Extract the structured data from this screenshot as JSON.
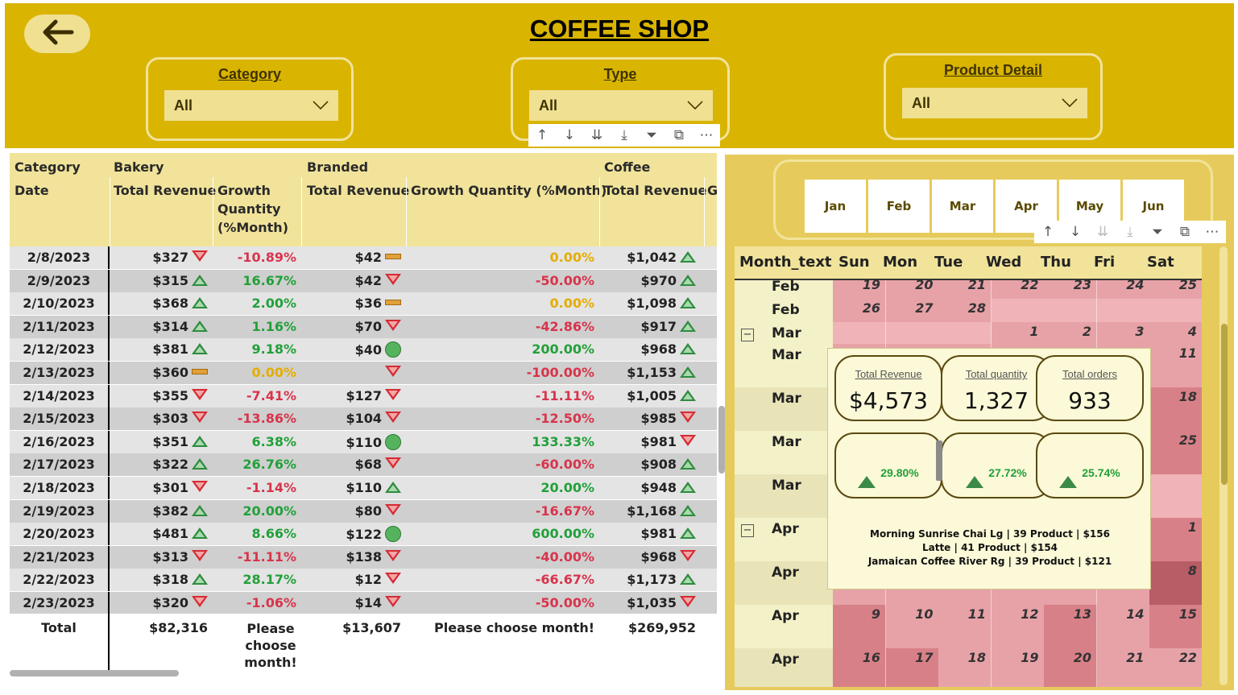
{
  "title": "COFFEE SHOP",
  "colors": {
    "header_bg": "#d9b400",
    "slicer_bg": "#efe092",
    "table_header_bg": "#f1e39a",
    "positive": "#22a03a",
    "negative": "#d8344b",
    "neutral": "#e5ad00"
  },
  "icons": {
    "back": "back-arrow-icon",
    "dropdown": "chevron-down-icon"
  },
  "filters": [
    {
      "title": "Category",
      "value": "All"
    },
    {
      "title": "Type",
      "value": "All"
    },
    {
      "title": "Product Detail",
      "value": "All"
    }
  ],
  "table_toolbar": [
    "sort-ascending-icon",
    "sort-descending-icon",
    "expand-all-icon",
    "drill-down-icon",
    "filter-icon",
    "focus-mode-icon",
    "more-options-icon"
  ],
  "table": {
    "row_header_title": "Category",
    "date_header": "Date",
    "groups": [
      {
        "name": "Bakery",
        "revenue_label": "Total Revenue",
        "growth_label": "Growth Quantity (%Month)"
      },
      {
        "name": "Branded",
        "revenue_label": "Total Revenue",
        "growth_label": "Growth Quantity (%Month)"
      },
      {
        "name": "Coffee",
        "revenue_label": "Total Revenue",
        "growth_label": "G"
      }
    ],
    "growth_wrapped": [
      "Growth",
      "Quantity",
      "(%Month)"
    ],
    "rows": [
      {
        "date": "2/8/2023",
        "bak_rev": "$327",
        "bak_icon": "down",
        "bak_gr": "-10.89%",
        "bak_cls": "neg",
        "brd_rev": "$42",
        "brd_icon": "flat",
        "brd_gr": "0.00%",
        "brd_cls": "zero",
        "cof_rev": "$1,042",
        "cof_icon": "up"
      },
      {
        "date": "2/9/2023",
        "bak_rev": "$315",
        "bak_icon": "up",
        "bak_gr": "16.67%",
        "bak_cls": "pos",
        "brd_rev": "$42",
        "brd_icon": "down",
        "brd_gr": "-50.00%",
        "brd_cls": "neg",
        "cof_rev": "$970",
        "cof_icon": "up"
      },
      {
        "date": "2/10/2023",
        "bak_rev": "$368",
        "bak_icon": "up",
        "bak_gr": "2.00%",
        "bak_cls": "pos",
        "brd_rev": "$36",
        "brd_icon": "flat",
        "brd_gr": "0.00%",
        "brd_cls": "zero",
        "cof_rev": "$1,098",
        "cof_icon": "up"
      },
      {
        "date": "2/11/2023",
        "bak_rev": "$314",
        "bak_icon": "up",
        "bak_gr": "1.16%",
        "bak_cls": "pos",
        "brd_rev": "$70",
        "brd_icon": "down",
        "brd_gr": "-42.86%",
        "brd_cls": "neg",
        "cof_rev": "$917",
        "cof_icon": "up"
      },
      {
        "date": "2/12/2023",
        "bak_rev": "$381",
        "bak_icon": "up",
        "bak_gr": "9.18%",
        "bak_cls": "pos",
        "brd_rev": "$40",
        "brd_icon": "circle",
        "brd_gr": "200.00%",
        "brd_cls": "pos",
        "cof_rev": "$968",
        "cof_icon": "up"
      },
      {
        "date": "2/13/2023",
        "bak_rev": "$360",
        "bak_icon": "flat",
        "bak_gr": "0.00%",
        "bak_cls": "zero",
        "brd_rev": "",
        "brd_icon": "down",
        "brd_gr": "-100.00%",
        "brd_cls": "neg",
        "cof_rev": "$1,153",
        "cof_icon": "up"
      },
      {
        "date": "2/14/2023",
        "bak_rev": "$355",
        "bak_icon": "down",
        "bak_gr": "-7.41%",
        "bak_cls": "neg",
        "brd_rev": "$127",
        "brd_icon": "down",
        "brd_gr": "-11.11%",
        "brd_cls": "neg",
        "cof_rev": "$1,005",
        "cof_icon": "up"
      },
      {
        "date": "2/15/2023",
        "bak_rev": "$303",
        "bak_icon": "down",
        "bak_gr": "-13.86%",
        "bak_cls": "neg",
        "brd_rev": "$104",
        "brd_icon": "down",
        "brd_gr": "-12.50%",
        "brd_cls": "neg",
        "cof_rev": "$985",
        "cof_icon": "down"
      },
      {
        "date": "2/16/2023",
        "bak_rev": "$351",
        "bak_icon": "up",
        "bak_gr": "6.38%",
        "bak_cls": "pos",
        "brd_rev": "$110",
        "brd_icon": "circle",
        "brd_gr": "133.33%",
        "brd_cls": "pos",
        "cof_rev": "$981",
        "cof_icon": "down"
      },
      {
        "date": "2/17/2023",
        "bak_rev": "$322",
        "bak_icon": "up",
        "bak_gr": "26.76%",
        "bak_cls": "pos",
        "brd_rev": "$68",
        "brd_icon": "down",
        "brd_gr": "-60.00%",
        "brd_cls": "neg",
        "cof_rev": "$908",
        "cof_icon": "up"
      },
      {
        "date": "2/18/2023",
        "bak_rev": "$301",
        "bak_icon": "down",
        "bak_gr": "-1.14%",
        "bak_cls": "neg",
        "brd_rev": "$110",
        "brd_icon": "up",
        "brd_gr": "20.00%",
        "brd_cls": "pos",
        "cof_rev": "$948",
        "cof_icon": "up"
      },
      {
        "date": "2/19/2023",
        "bak_rev": "$382",
        "bak_icon": "up",
        "bak_gr": "20.00%",
        "bak_cls": "pos",
        "brd_rev": "$80",
        "brd_icon": "down",
        "brd_gr": "-16.67%",
        "brd_cls": "neg",
        "cof_rev": "$1,168",
        "cof_icon": "up"
      },
      {
        "date": "2/20/2023",
        "bak_rev": "$481",
        "bak_icon": "up",
        "bak_gr": "8.66%",
        "bak_cls": "pos",
        "brd_rev": "$122",
        "brd_icon": "circle",
        "brd_gr": "600.00%",
        "brd_cls": "pos",
        "cof_rev": "$981",
        "cof_icon": "up"
      },
      {
        "date": "2/21/2023",
        "bak_rev": "$313",
        "bak_icon": "down",
        "bak_gr": "-11.11%",
        "bak_cls": "neg",
        "brd_rev": "$138",
        "brd_icon": "down",
        "brd_gr": "-40.00%",
        "brd_cls": "neg",
        "cof_rev": "$968",
        "cof_icon": "down"
      },
      {
        "date": "2/22/2023",
        "bak_rev": "$318",
        "bak_icon": "up",
        "bak_gr": "28.17%",
        "bak_cls": "pos",
        "brd_rev": "$12",
        "brd_icon": "down",
        "brd_gr": "-66.67%",
        "brd_cls": "neg",
        "cof_rev": "$1,173",
        "cof_icon": "up"
      },
      {
        "date": "2/23/2023",
        "bak_rev": "$320",
        "bak_icon": "down",
        "bak_gr": "-1.06%",
        "bak_cls": "neg",
        "brd_rev": "$14",
        "brd_icon": "down",
        "brd_gr": "-50.00%",
        "brd_cls": "neg",
        "cof_rev": "$1,035",
        "cof_icon": "down"
      }
    ],
    "total": {
      "label": "Total",
      "bak_rev": "$82,316",
      "bak_gr_lines": [
        "Please",
        "choose",
        "month!"
      ],
      "brd_rev": "$13,607",
      "brd_gr": "Please choose month!",
      "cof_rev": "$269,952"
    }
  },
  "month_slicer": [
    "Jan",
    "Feb",
    "Mar",
    "Apr",
    "May",
    "Jun"
  ],
  "calendar_toolbar": [
    "sort-ascending-icon",
    "sort-descending-icon",
    "expand-all-icon",
    "drill-down-icon",
    "filter-icon",
    "focus-mode-icon",
    "more-options-icon"
  ],
  "calendar": {
    "row_header": "Month_text",
    "weekdays": [
      "Sun",
      "Mon",
      "Tue",
      "Wed",
      "Thu",
      "Fri",
      "Sat"
    ],
    "rows": [
      {
        "label": "Feb",
        "expand": "",
        "alt": false,
        "days": [
          "19",
          "20",
          "21",
          "22",
          "23",
          "24",
          "25"
        ],
        "shade": [
          2,
          2,
          2,
          2,
          2,
          2,
          2
        ]
      },
      {
        "label": "Feb",
        "expand": "",
        "alt": false,
        "days": [
          "26",
          "27",
          "28",
          "",
          "",
          "",
          ""
        ],
        "shade": [
          2,
          2,
          2,
          1,
          1,
          1,
          1
        ]
      },
      {
        "label": "Mar",
        "expand": "−",
        "alt": false,
        "days": [
          "",
          "",
          "",
          "1",
          "2",
          "3",
          "4"
        ],
        "shade": [
          1,
          1,
          1,
          2,
          2,
          2,
          2
        ]
      },
      {
        "label": "Mar",
        "expand": "",
        "alt": false,
        "days": [
          "",
          "",
          "",
          "",
          "",
          "",
          "11"
        ],
        "shade": [
          2,
          2,
          2,
          2,
          2,
          2,
          2
        ]
      },
      {
        "label": "Mar",
        "expand": "",
        "alt": true,
        "days": [
          "",
          "",
          "",
          "",
          "",
          "",
          "18"
        ],
        "shade": [
          2,
          2,
          2,
          2,
          2,
          2,
          3
        ]
      },
      {
        "label": "Mar",
        "expand": "",
        "alt": false,
        "days": [
          "",
          "",
          "",
          "",
          "",
          "",
          "25"
        ],
        "shade": [
          2,
          2,
          2,
          2,
          2,
          2,
          3
        ]
      },
      {
        "label": "Mar",
        "expand": "",
        "alt": true,
        "days": [
          "",
          "",
          "",
          "",
          "",
          "",
          ""
        ],
        "shade": [
          2,
          2,
          2,
          2,
          2,
          2,
          1
        ]
      },
      {
        "label": "Apr",
        "expand": "−",
        "alt": false,
        "days": [
          "",
          "",
          "",
          "",
          "",
          "",
          "1"
        ],
        "shade": [
          1,
          1,
          1,
          1,
          1,
          2,
          3
        ]
      },
      {
        "label": "Apr",
        "expand": "",
        "alt": true,
        "days": [
          "",
          "",
          "",
          "",
          "",
          "",
          "8"
        ],
        "shade": [
          2,
          2,
          2,
          2,
          2,
          2,
          4
        ]
      },
      {
        "label": "Apr",
        "expand": "",
        "alt": false,
        "days": [
          "9",
          "10",
          "11",
          "12",
          "13",
          "14",
          "15"
        ],
        "shade": [
          3,
          2,
          2,
          2,
          3,
          2,
          3
        ]
      },
      {
        "label": "Apr",
        "expand": "",
        "alt": true,
        "days": [
          "16",
          "17",
          "18",
          "19",
          "20",
          "21",
          "22"
        ],
        "shade": [
          3,
          3,
          2,
          2,
          3,
          2,
          2
        ]
      }
    ]
  },
  "tooltip": {
    "kpis": [
      {
        "label": "Total Revenue",
        "value": "$4,573",
        "growth": "29.80%"
      },
      {
        "label": "Total quantity",
        "value": "1,327",
        "growth": "27.72%"
      },
      {
        "label": "Total orders",
        "value": "933",
        "growth": "25.74%"
      }
    ],
    "products": [
      "Morning Sunrise Chai Lg | 39 Product | $156",
      "Latte | 41 Product | $154",
      "Jamaican Coffee River Rg | 39 Product | $121"
    ]
  }
}
